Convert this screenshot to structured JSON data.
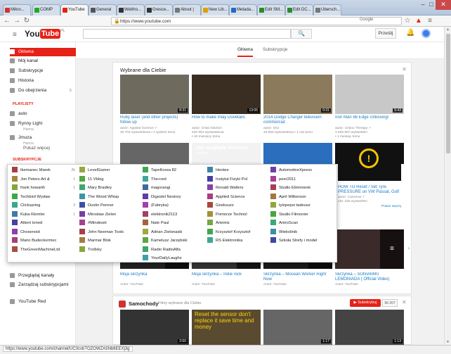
{
  "browser": {
    "tabs": [
      {
        "label": "Mikro...",
        "color": "#c33"
      },
      {
        "label": "COMP",
        "color": "#2a2"
      },
      {
        "label": "YouTube",
        "color": "#e62117"
      },
      {
        "label": "General",
        "color": "#555"
      },
      {
        "label": "Webho...",
        "color": "#333"
      },
      {
        "label": "Gresce...",
        "color": "#333"
      },
      {
        "label": "About |",
        "color": "#777"
      },
      {
        "label": "New Lib...",
        "color": "#dca000"
      },
      {
        "label": "Metada...",
        "color": "#2268c8"
      },
      {
        "label": "Edit SM...",
        "color": "#2a8a2a"
      },
      {
        "label": "Edit DC...",
        "color": "#2a8a2a"
      },
      {
        "label": "Ubersch...",
        "color": "#777"
      }
    ],
    "url": "https://www.youtube.com",
    "search_engine": "Google",
    "status_url": "https://www.youtube.com/channel/UC0cvbTOZOWZA5Nb6EEXj3g"
  },
  "header": {
    "logo_you": "You",
    "logo_tube": "Tube",
    "logo_country": "PL",
    "search_placeholder": "",
    "upload_label": "Prześlij"
  },
  "sidebar": {
    "items": [
      {
        "label": "Główna",
        "active": true
      },
      {
        "label": "Mój kanał",
        "active": false
      },
      {
        "label": "Subskrypcje",
        "active": false
      },
      {
        "label": "Historia",
        "active": false
      },
      {
        "label": "Do obejrzenia",
        "active": false,
        "count": "5"
      }
    ],
    "playlists_header": "PLAYLISTY",
    "playlists": [
      {
        "label": "auto",
        "sub": ""
      },
      {
        "label": "Rynny Light",
        "sub": "Hanna"
      },
      {
        "label": "Jmuza",
        "sub": "Hanna"
      }
    ],
    "more_label": "Pokaż więcej",
    "subs_header": "SUBSKRYPCJE",
    "bottom": [
      {
        "label": "Przeglądaj kanały"
      },
      {
        "label": "Zarządzaj subskrypcjami"
      },
      {
        "label": "YouTube Red"
      }
    ]
  },
  "feed_tabs": [
    "Główna",
    "Subskrypcje"
  ],
  "recommended": {
    "title": "Wybrane dla Ciebie",
    "videos": [
      {
        "title": "Ruby laser (and other projects) follow up",
        "meta1": "autor: Applied Science ✓",
        "meta2": "45 704 wyświetlenia • 1 tydzień temu",
        "duration": "8:31",
        "color": "#6e6a5e"
      },
      {
        "title": "How to make Inlay Dovetails",
        "meta1": "autor: Chad Stanton",
        "meta2": "440 564 wyświetlenia",
        "meta3": "• 10 miesięcy temu",
        "duration": "13:05",
        "color": "#3a2e22"
      },
      {
        "title": "2014 Dodge Charger television commercial",
        "meta1": "autor: SSJ",
        "meta2": "34 653 wyświetlenia • 1 rok temu",
        "duration": "0:31",
        "color": "#8c7a5c"
      },
      {
        "title": "Iron Man 86 Edge Unboxing!",
        "meta1": "autor: Unbox Therapy ✓",
        "meta2": "1 825 807 wyświetleń",
        "meta3": "• 1 miesiąc temu",
        "duration": "5:43",
        "color": "#c8c8c8"
      }
    ],
    "row2": [
      {
        "title": "Moja skrzynka",
        "meta1": "Autor: YouTube",
        "duration": "",
        "color": "#222"
      },
      {
        "title": "Moja skrzynka – Indie rock",
        "meta1": "Autor: YouTube",
        "duration": "",
        "color": "#333"
      },
      {
        "title": "Skrzynka – Mocean Worker Right Now",
        "meta1": "Autor: YouTube",
        "duration": "",
        "color": "#444"
      },
      {
        "title": "Skrzynka – SONIAMIKI LEMONIADA ( Official Video)",
        "meta1": "Autor: YouTube",
        "duration": "",
        "color": "#553"
      }
    ],
    "right_partial": {
      "title": "HOW TO Reset / Set Tyre PRESSURE on VW Passat, Golf",
      "meta1": "autor: CarsHow ✓",
      "meta2": "151 155 wyświetleń",
      "duration": "",
      "more": "Pokaż więcej"
    },
    "right_partial2": {
      "title": "HOW TO Reset / Set Tyre",
      "duration": ""
    },
    "overlay_title": "Jak wygląda Stronce",
    "overlay_sub": "i niebo"
  },
  "subscriptions_popup": {
    "cols": [
      [
        "Ikemanec Marek",
        "Jon Peters Art &",
        "frank howarth",
        "Techbird Wydaw",
        "Clickspring",
        "Kuba Klemler",
        "Attent toned",
        "Chosenoid",
        "Mario Budeckermec",
        "TheGreenMachineLtd"
      ],
      [
        "LevelGamer",
        "11 Vblog",
        "Mary Bradley",
        "The Wood Whisp",
        "Dustin Penner",
        "Mirosław Zielen",
        "#Mindeset",
        "John Neeman Tools",
        "Marmar Blok",
        "Trollsky"
      ],
      [
        "TapeKorea 82",
        "The+red",
        "magorangi",
        "Digestel Nestory",
        "(Fabryka)",
        "elektronik2113",
        "Nate Paul",
        "Adrian Zielonaski",
        "Kamelusz Jarzębski",
        "Radio RadioAlfa",
        "YourDailyLaughs"
      ],
      [
        "Hentee",
        "Instytut Fizyki Pol",
        "Ronald Walters",
        "Applied Science",
        "Geeksuzz",
        "Pomorze Technol",
        "Artemis",
        "Krzysztof Krzysztof",
        "RS Elektronika"
      ],
      [
        "AutomotiveXpress",
        "peer2011",
        "Studio Eliminorek",
        "April Wilkerson",
        "tylopepsi tadeusz",
        "Studio Filmonier",
        "AntroScan",
        "Wieloślnik",
        "Szkoła Strefy i model"
      ]
    ],
    "counts": [
      "2b",
      "1",
      "1",
      "",
      "3",
      "1",
      "",
      "",
      "",
      ""
    ]
  },
  "cars": {
    "title": "Samochody",
    "subtitle": "Filmy wybrane dla Ciebie",
    "subscribe_label": "Subskrybuj",
    "subscribe_count": "90 207",
    "thumbs": [
      {
        "duration": "2:00",
        "color": "#333"
      },
      {
        "duration": "",
        "color": "#5a4a30",
        "caption": "Reset the sensor don't replace it save time and money"
      },
      {
        "duration": "1:17",
        "color": "#666"
      },
      {
        "duration": "1:13",
        "color": "#444"
      }
    ]
  }
}
